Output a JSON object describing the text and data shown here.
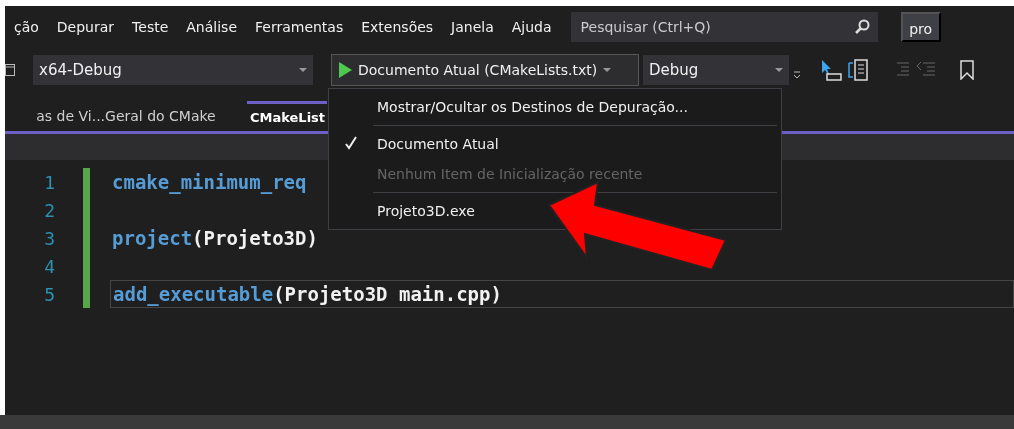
{
  "menu_bar": {
    "items": [
      {
        "label": "ção"
      },
      {
        "label": "Depurar"
      },
      {
        "label": "Teste"
      },
      {
        "label": "Análise"
      },
      {
        "label": "Ferramentas"
      },
      {
        "label": "Extensões"
      },
      {
        "label": "Janela"
      },
      {
        "label": "Ajuda"
      }
    ],
    "search": {
      "placeholder": "Pesquisar (Ctrl+Q)"
    },
    "account": {
      "label": "pro"
    }
  },
  "toolbar": {
    "platform": {
      "value": "x64-Debug"
    },
    "start_button": {
      "label": "Documento Atual (CMakeLists.txt)"
    },
    "configuration": {
      "value": "Debug"
    }
  },
  "tabs": [
    {
      "label": "as de Vi...Geral do CMake",
      "selected": false
    },
    {
      "label": "CMakeList",
      "selected": true
    }
  ],
  "editor": {
    "lines": [
      {
        "number": "1",
        "keyword": "cmake_minimum_req"
      },
      {
        "number": "2"
      },
      {
        "number": "3",
        "keyword": "project",
        "rest": "(Projeto3D)"
      },
      {
        "number": "4"
      },
      {
        "number": "5",
        "keyword": "add_executable",
        "rest": "(Projeto3D main.cpp)",
        "current": true
      }
    ]
  },
  "dropdown_menu": {
    "items": [
      {
        "kind": "item",
        "label": "Mostrar/Ocultar os Destinos de Depuração...",
        "checked": false,
        "disabled": false
      },
      {
        "kind": "separator"
      },
      {
        "kind": "item",
        "label": "Documento Atual",
        "checked": true,
        "disabled": false
      },
      {
        "kind": "item",
        "label": "Nenhum Item de Inicialização recente",
        "checked": false,
        "disabled": true
      },
      {
        "kind": "separator"
      },
      {
        "kind": "item",
        "label": "Projeto3D.exe",
        "checked": false,
        "disabled": false
      }
    ]
  },
  "annotation": {
    "kind": "arrow",
    "color": "#ff0000"
  }
}
